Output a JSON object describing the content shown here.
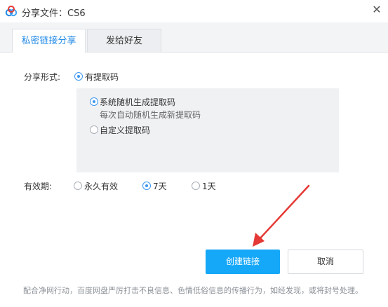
{
  "window": {
    "title": "分享文件：CS6",
    "close_glyph": "✕",
    "logo_icon": "baidu-netdisk-cloud-icon"
  },
  "tabs": [
    {
      "label": "私密链接分享",
      "active": true
    },
    {
      "label": "发给好友",
      "active": false
    }
  ],
  "share_form": {
    "label": "分享形式:",
    "option": "有提取码",
    "selected": true
  },
  "code_options": {
    "random": {
      "label": "系统随机生成提取码",
      "hint": "每次自动随机生成新提取码",
      "selected": true
    },
    "custom": {
      "label": "自定义提取码",
      "selected": false
    }
  },
  "validity": {
    "label": "有效期:",
    "options": [
      {
        "label": "永久有效",
        "selected": false
      },
      {
        "label": "7天",
        "selected": true
      },
      {
        "label": "1天",
        "selected": false
      }
    ]
  },
  "buttons": {
    "create": "创建链接",
    "cancel": "取消"
  },
  "footer": "配合净网行动，百度网盘严厉打击不良信息、色情低俗信息的传播行为，如经发现，或将封号处理。",
  "colors": {
    "accent": "#16a8f8",
    "tab_active_text": "#1e88e5",
    "annotation_arrow": "#e53935"
  }
}
